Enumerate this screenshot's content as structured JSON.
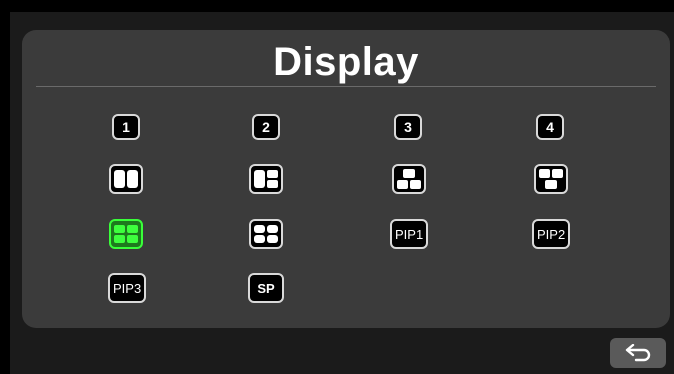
{
  "title": "Display",
  "buttons": {
    "view_1": "1",
    "view_2": "2",
    "view_3": "3",
    "view_4": "4",
    "pip1": "PIP1",
    "pip2": "PIP2",
    "pip3": "PIP3",
    "sp": "SP"
  },
  "active_layout": "quad-split",
  "colors": {
    "active_border": "#39ff39",
    "active_fill": "#1e7a1e"
  },
  "back_icon": "return-arrow-icon"
}
